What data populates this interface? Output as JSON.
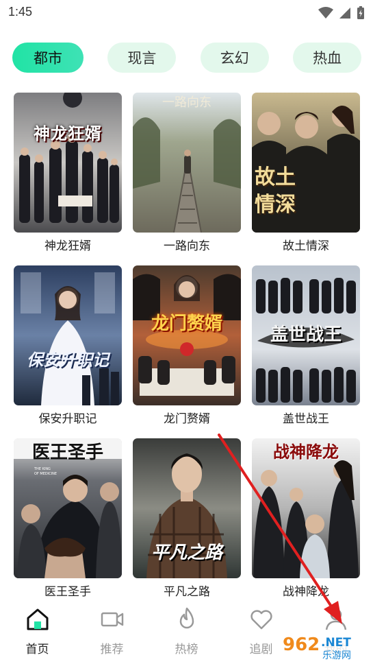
{
  "status": {
    "time": "1:45"
  },
  "tabs": [
    {
      "label": "都市",
      "active": true
    },
    {
      "label": "现言",
      "active": false
    },
    {
      "label": "玄幻",
      "active": false
    },
    {
      "label": "热血",
      "active": false
    }
  ],
  "items": [
    {
      "title": "神龙狂婿",
      "poster_text": "神龙狂婿"
    },
    {
      "title": "一路向东",
      "poster_text": ""
    },
    {
      "title": "故土情深",
      "poster_text": "故土情深"
    },
    {
      "title": "保安升职记",
      "poster_text": "保安升职记"
    },
    {
      "title": "龙门赘婿",
      "poster_text": "龙门赘婿"
    },
    {
      "title": "盖世战王",
      "poster_text": "盖世战王"
    },
    {
      "title": "医王圣手",
      "poster_text": "医王圣手"
    },
    {
      "title": "平凡之路",
      "poster_text": "平凡之路"
    },
    {
      "title": "战神降龙",
      "poster_text": "战神降龙"
    }
  ],
  "nav": [
    {
      "label": "首页",
      "icon": "home-icon",
      "active": true
    },
    {
      "label": "推荐",
      "icon": "video-icon",
      "active": false
    },
    {
      "label": "热榜",
      "icon": "flame-icon",
      "active": false
    },
    {
      "label": "追剧",
      "icon": "heart-icon",
      "active": false
    },
    {
      "label": "我的",
      "icon": "user-icon",
      "active": false
    }
  ],
  "watermark": {
    "main": "962.NET",
    "sub": "乐游网"
  },
  "colors": {
    "accent": "#21e3a5",
    "tab_bg": "#e3f8ec",
    "arrow": "#e02020"
  }
}
